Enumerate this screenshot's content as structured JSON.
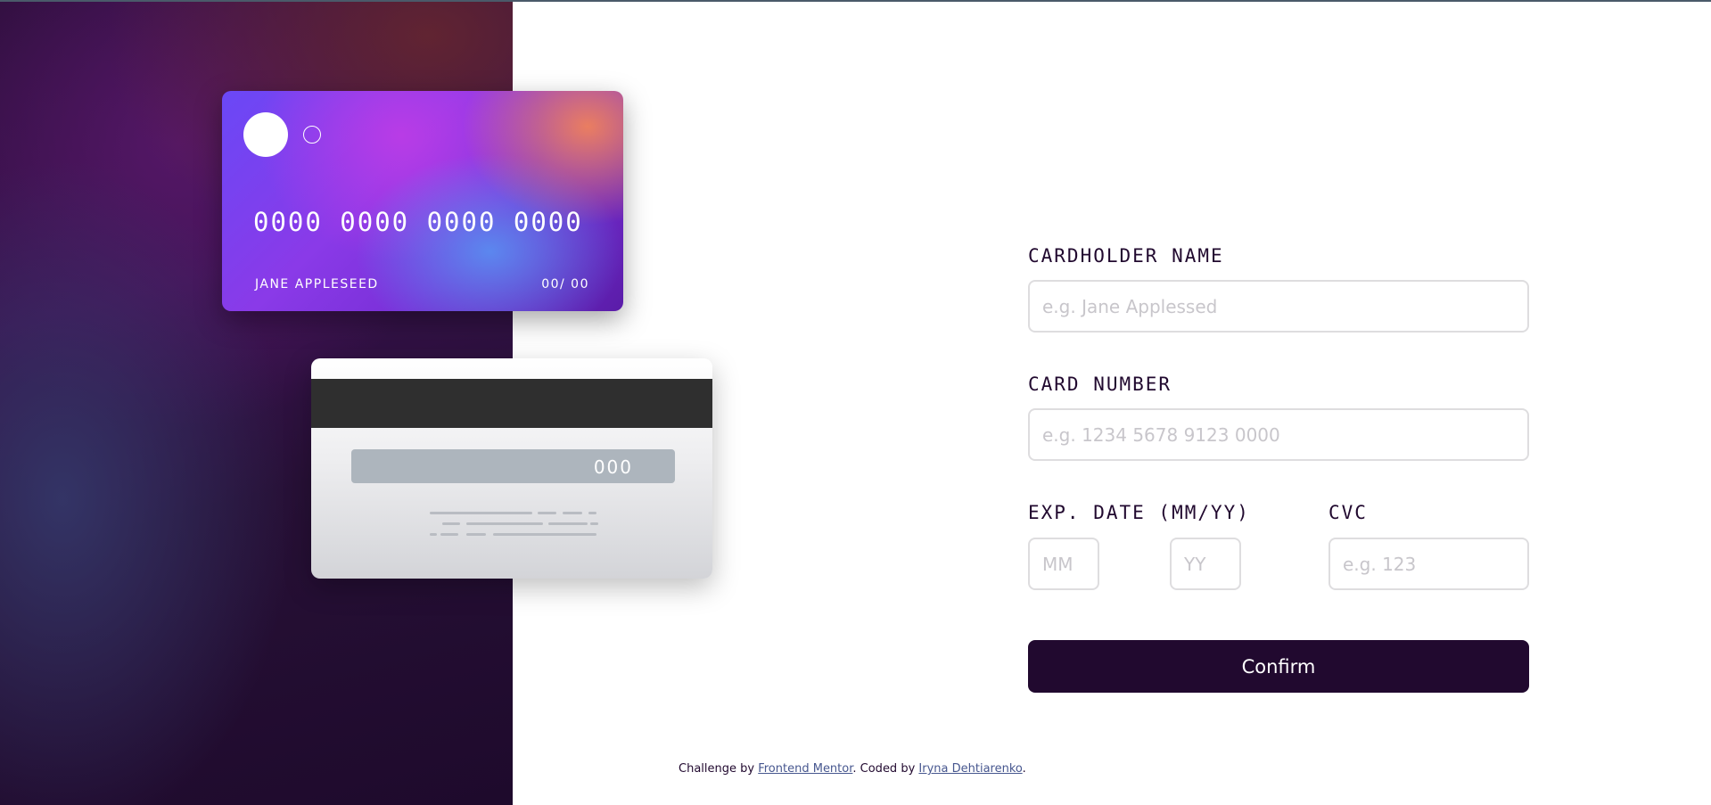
{
  "card_front": {
    "number": "0000 0000 0000 0000",
    "name": "JANE APPLESEED",
    "expiry": "00/ 00"
  },
  "card_back": {
    "cvc": "000"
  },
  "form": {
    "cardholder_label": "CARDHOLDER NAME",
    "cardholder_placeholder": "e.g. Jane Applessed",
    "cardholder_value": "",
    "number_label": "CARD NUMBER",
    "number_placeholder": "e.g. 1234 5678 9123 0000",
    "number_value": "",
    "exp_label": "EXP. DATE (MM/YY)",
    "month_placeholder": "MM",
    "month_value": "",
    "year_placeholder": "YY",
    "year_value": "",
    "cvc_label": "CVC",
    "cvc_placeholder": "e.g. 123",
    "cvc_value": "",
    "confirm_label": "Confirm"
  },
  "footer": {
    "prefix": "Challenge by ",
    "link1": "Frontend Mentor",
    "middle": ". Coded by ",
    "link2": "Iryna Dehtiarenko",
    "suffix": "."
  },
  "colors": {
    "dark_violet": "#21092f",
    "input_border": "#dedddf",
    "placeholder": "#c8c6cb",
    "link": "#47578f"
  },
  "icons": [
    "card-logo-filled-circle-icon",
    "card-logo-outline-circle-icon"
  ]
}
